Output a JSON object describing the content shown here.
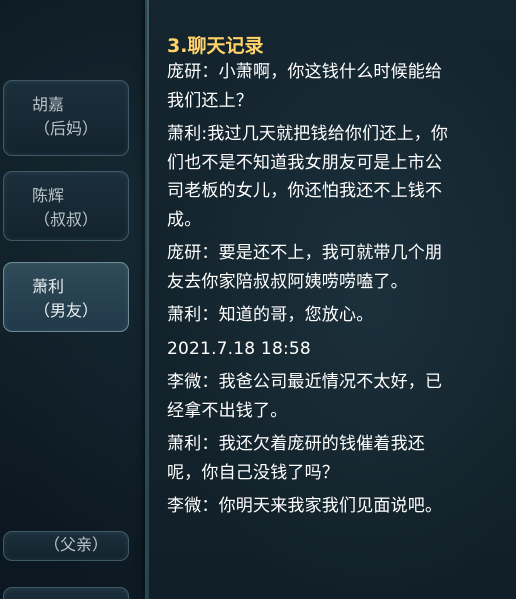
{
  "characters": [
    {
      "name": "胡嘉",
      "role": "（后妈）",
      "selected": false
    },
    {
      "name": "陈辉",
      "role": "（叔叔）",
      "selected": false
    },
    {
      "name": "萧利",
      "role": "（男友）",
      "selected": true
    },
    {
      "name": "",
      "role": "（父亲）",
      "selected": false
    },
    {
      "name": "",
      "role": "",
      "selected": false
    }
  ],
  "record": {
    "title": "3.聊天记录",
    "messages": [
      {
        "lines": [
          "庞研：小萧啊，你这钱什么时候能给",
          "我们还上？"
        ]
      },
      {
        "lines": [
          "萧利:我过几天就把钱给你们还上，你",
          "们也不是不知道我女朋友可是上市公",
          "司老板的女儿，你还怕我还不上钱不",
          "成。"
        ]
      },
      {
        "lines": [
          "庞研：要是还不上，我可就带几个朋",
          "友去你家陪叔叔阿姨唠唠嗑了。"
        ]
      },
      {
        "lines": [
          "萧利：知道的哥，您放心。"
        ]
      },
      {
        "lines": [
          "2021.7.18 18:58"
        ]
      },
      {
        "lines": [
          "李微：我爸公司最近情况不太好，已",
          "经拿不出钱了。"
        ]
      },
      {
        "lines": [
          "萧利：我还欠着庞研的钱催着我还",
          "呢，你自己没钱了吗？"
        ]
      },
      {
        "lines": [
          "李微：你明天来我家我们见面说吧。"
        ]
      }
    ]
  }
}
